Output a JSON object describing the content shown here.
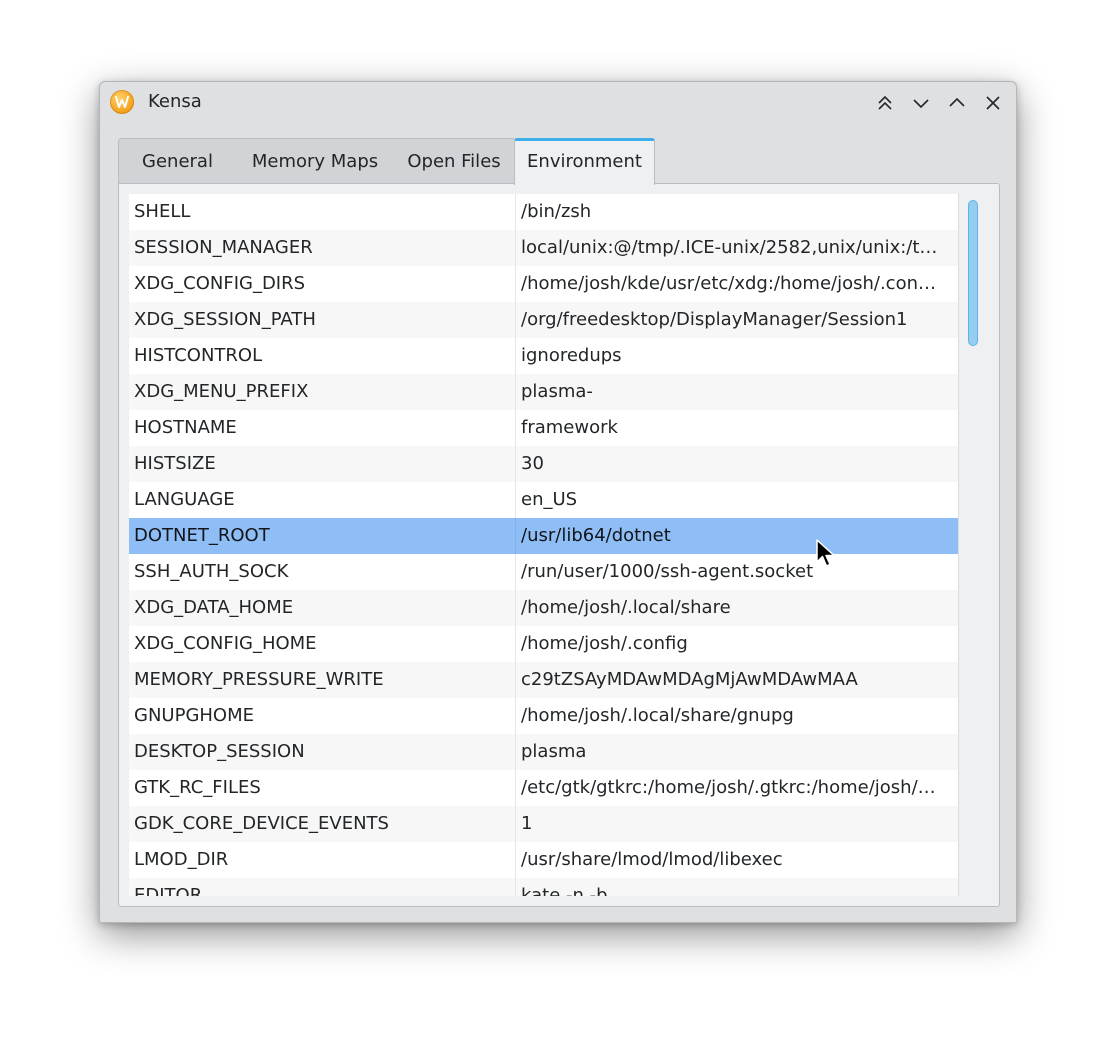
{
  "window": {
    "title": "Kensa",
    "app_icon": "kensa-logo-icon",
    "buttons": [
      "keep-above-icon",
      "minimize-icon",
      "maximize-icon",
      "close-icon"
    ]
  },
  "tabs": [
    {
      "label": "General",
      "active": false
    },
    {
      "label": "Memory Maps",
      "active": false
    },
    {
      "label": "Open Files",
      "active": false
    },
    {
      "label": "Environment",
      "active": true
    }
  ],
  "environment": {
    "rows": [
      {
        "name": "SHELL",
        "value": "/bin/zsh"
      },
      {
        "name": "SESSION_MANAGER",
        "value": "local/unix:@/tmp/.ICE-unix/2582,unix/unix:/t…"
      },
      {
        "name": "XDG_CONFIG_DIRS",
        "value": "/home/josh/kde/usr/etc/xdg:/home/josh/.con…"
      },
      {
        "name": "XDG_SESSION_PATH",
        "value": "/org/freedesktop/DisplayManager/Session1"
      },
      {
        "name": "HISTCONTROL",
        "value": "ignoredups"
      },
      {
        "name": "XDG_MENU_PREFIX",
        "value": "plasma-"
      },
      {
        "name": "HOSTNAME",
        "value": "framework"
      },
      {
        "name": "HISTSIZE",
        "value": "30"
      },
      {
        "name": "LANGUAGE",
        "value": "en_US"
      },
      {
        "name": "DOTNET_ROOT",
        "value": "/usr/lib64/dotnet"
      },
      {
        "name": "SSH_AUTH_SOCK",
        "value": "/run/user/1000/ssh-agent.socket"
      },
      {
        "name": "XDG_DATA_HOME",
        "value": "/home/josh/.local/share"
      },
      {
        "name": "XDG_CONFIG_HOME",
        "value": "/home/josh/.config"
      },
      {
        "name": "MEMORY_PRESSURE_WRITE",
        "value": "c29tZSAyMDAwMDAgMjAwMDAwMAA"
      },
      {
        "name": "GNUPGHOME",
        "value": "/home/josh/.local/share/gnupg"
      },
      {
        "name": "DESKTOP_SESSION",
        "value": "plasma"
      },
      {
        "name": "GTK_RC_FILES",
        "value": "/etc/gtk/gtkrc:/home/josh/.gtkrc:/home/josh/…"
      },
      {
        "name": "GDK_CORE_DEVICE_EVENTS",
        "value": "1"
      },
      {
        "name": "LMOD_DIR",
        "value": "/usr/share/lmod/lmod/libexec"
      },
      {
        "name": "EDITOR",
        "value": "kate -n -b"
      }
    ],
    "selected_row": "DOTNET_ROOT"
  },
  "colors": {
    "selection": "#8fbef7",
    "accent": "#3daee9",
    "alt_row": "#f7f7f7"
  }
}
